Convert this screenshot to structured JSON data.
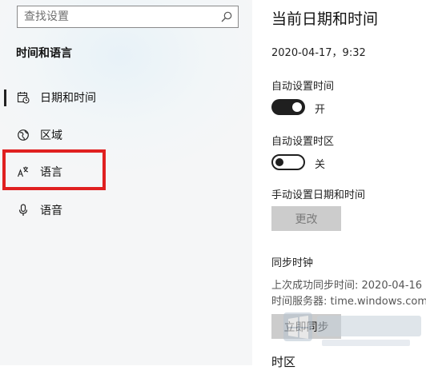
{
  "search": {
    "placeholder": "查找设置",
    "icon": "search-icon"
  },
  "sidebar": {
    "section_title": "时间和语言",
    "items": [
      {
        "label": "日期和时间",
        "icon": "calendar-clock-icon",
        "active": true
      },
      {
        "label": "区域",
        "icon": "globe-region-icon",
        "active": false
      },
      {
        "label": "语言",
        "icon": "language-icon",
        "active": false,
        "highlighted": true
      },
      {
        "label": "语音",
        "icon": "microphone-icon",
        "active": false
      }
    ]
  },
  "main": {
    "title": "当前日期和时间",
    "current_datetime": "2020-04-17，9:32",
    "auto_time": {
      "label": "自动设置时间",
      "state": "开",
      "on": true
    },
    "auto_timezone": {
      "label": "自动设置时区",
      "state": "关",
      "on": false
    },
    "manual": {
      "label": "手动设置日期和时间",
      "button": "更改"
    },
    "sync": {
      "heading": "同步时钟",
      "last_sync": "上次成功同步时间: 2020-04-16",
      "server": "时间服务器: time.windows.com",
      "button": "立即同步"
    },
    "next_heading_partial": "时区"
  },
  "colors": {
    "highlight": "#e02020",
    "toggle_on": "#1f1f1f",
    "disabled_button": "#cccccc"
  }
}
